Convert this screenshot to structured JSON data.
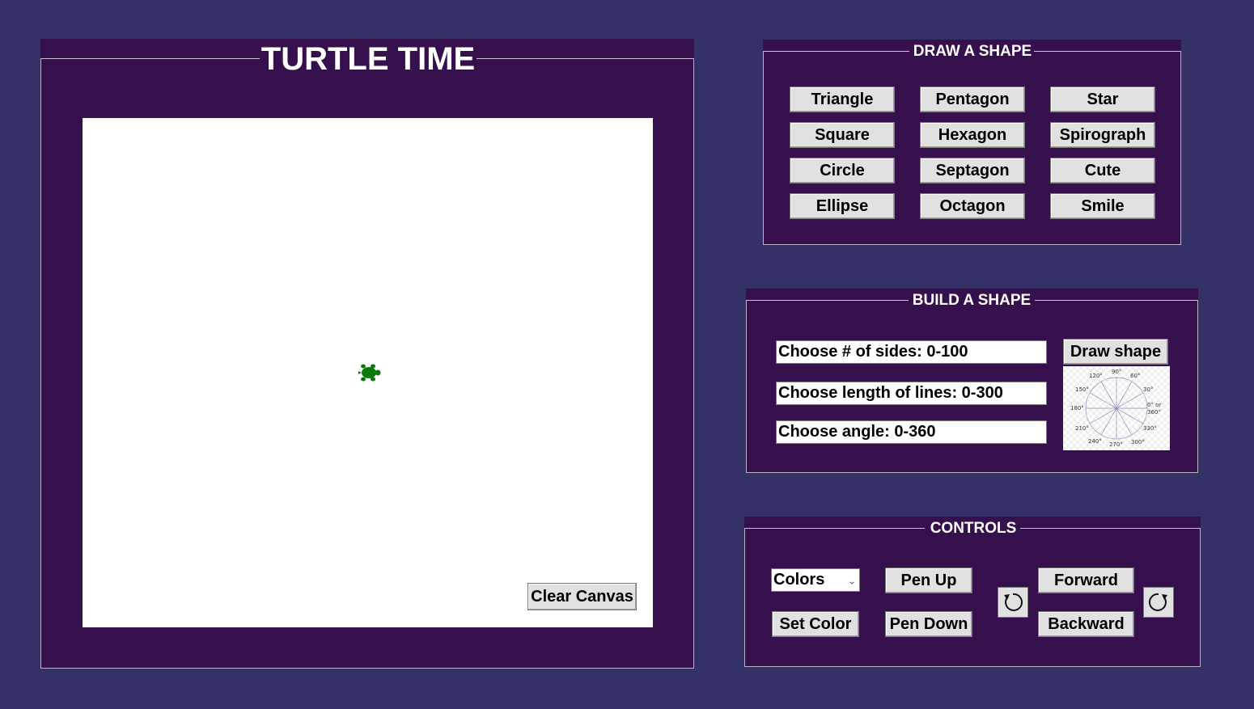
{
  "main": {
    "title": "TURTLE TIME",
    "clear_label": "Clear Canvas",
    "turtle_color": "#0a7a0a"
  },
  "draw_shape": {
    "legend": "DRAW A SHAPE",
    "buttons": [
      "Triangle",
      "Pentagon",
      "Star",
      "Square",
      "Hexagon",
      "Spirograph",
      "Circle",
      "Septagon",
      "Cute",
      "Ellipse",
      "Octagon",
      "Smile"
    ]
  },
  "build_shape": {
    "legend": "BUILD A SHAPE",
    "sides_placeholder": "Choose # of sides: 0-100",
    "length_placeholder": "Choose length of lines: 0-300",
    "angle_placeholder": "Choose angle: 0-360",
    "draw_label": "Draw shape",
    "angle_labels": [
      "90°",
      "60°",
      "30°",
      "0° or",
      "360°",
      "330°",
      "300°",
      "270°",
      "240°",
      "210°",
      "180°",
      "150°",
      "120°"
    ]
  },
  "controls": {
    "legend": "CONTROLS",
    "colors_selected": "Colors",
    "set_color_label": "Set Color",
    "pen_up_label": "Pen Up",
    "pen_down_label": "Pen Down",
    "forward_label": "Forward",
    "backward_label": "Backward"
  },
  "colors": {
    "background": "#343166",
    "panel": "#36104d",
    "button": "#e1e1e1"
  }
}
